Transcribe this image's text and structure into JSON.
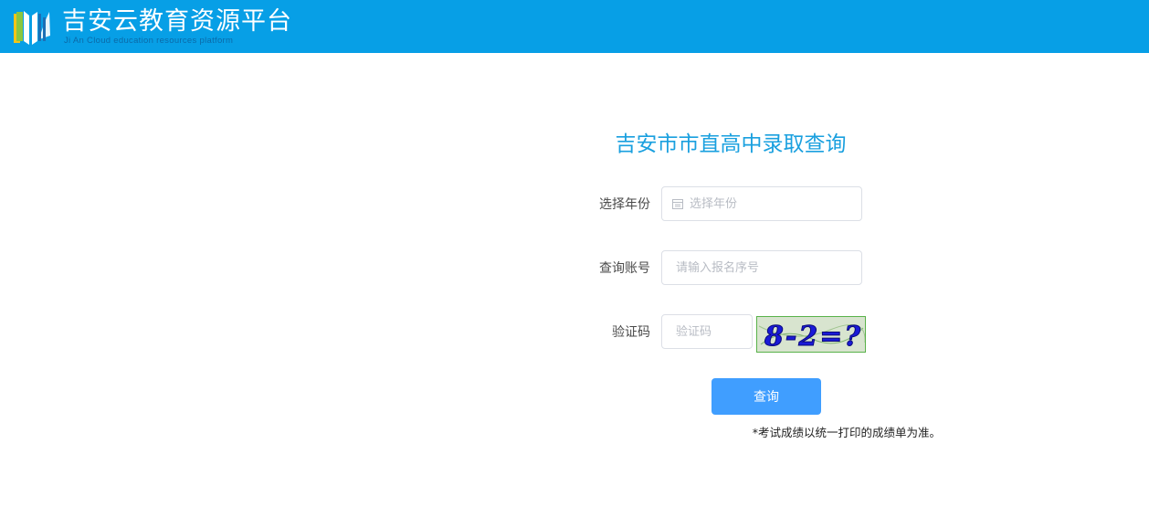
{
  "header": {
    "brand_cn": "吉安云教育资源平台",
    "brand_en": "Ji An Cloud education resources platform",
    "background": "#079fe6"
  },
  "form": {
    "title": "吉安市市直高中录取查询",
    "year": {
      "label": "选择年份",
      "placeholder": "选择年份",
      "icon": "calendar-icon"
    },
    "account": {
      "label": "查询账号",
      "placeholder": "请输入报名序号"
    },
    "captcha": {
      "label": "验证码",
      "placeholder": "验证码",
      "image_text": "8-2=?"
    },
    "submit_label": "查询",
    "note": "*考试成绩以统一打印的成绩单为准。",
    "accent": "#409eff",
    "title_color": "#1aa0df"
  }
}
